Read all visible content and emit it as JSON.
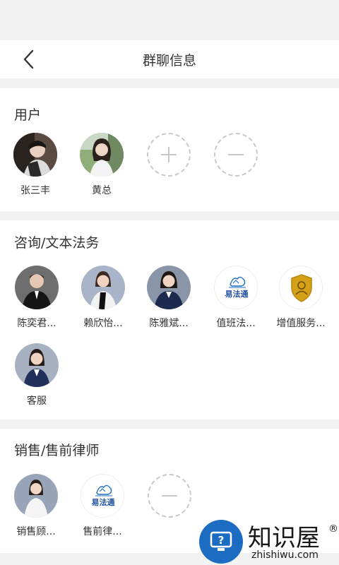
{
  "nav": {
    "title": "群聊信息",
    "back_icon": "chevron-left-icon"
  },
  "sections": {
    "users": {
      "title": "用户",
      "members": [
        {
          "name": "张三丰"
        },
        {
          "name": "黄总"
        }
      ]
    },
    "consult": {
      "title": "咨询/文本法务",
      "members": [
        {
          "name": "陈奕君..."
        },
        {
          "name": "赖欣怡..."
        },
        {
          "name": "陈雅斌..."
        },
        {
          "name": "值班法..."
        },
        {
          "name": "增值服务..."
        },
        {
          "name": "客服"
        }
      ]
    },
    "sales": {
      "title": "销售/售前律师",
      "members": [
        {
          "name": "销售顾..."
        },
        {
          "name": "售前律..."
        }
      ]
    }
  },
  "logo": {
    "text": "易法通"
  },
  "watermark": {
    "brand": "知识屋",
    "reg": "®",
    "url": "zhishiwu.com"
  },
  "colors": {
    "accent_blue": "#1f6fc2",
    "gold": "#d4a017",
    "dashed": "#c8c8c8"
  }
}
